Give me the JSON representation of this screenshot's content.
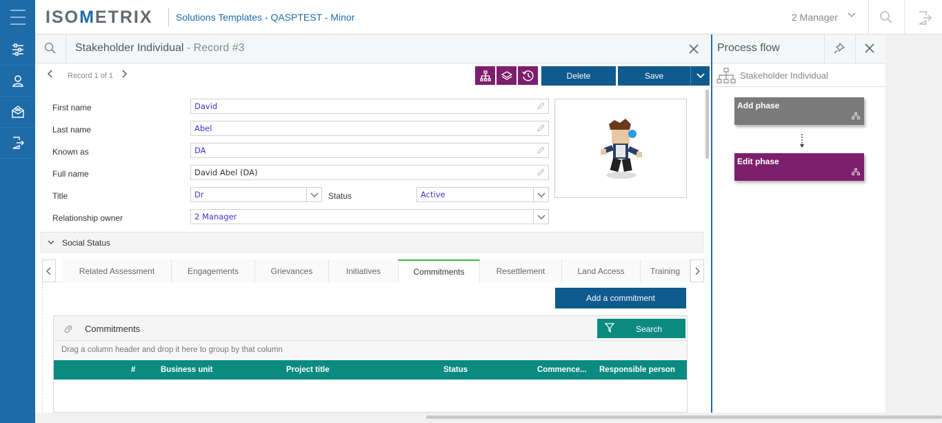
{
  "app": {
    "logo_prefix": "ISO",
    "logo_accent": "M",
    "logo_suffix": "ETRIX",
    "title": "Solutions Templates - QASPTEST - Minor",
    "user": "2 Manager"
  },
  "record": {
    "entity": "Stakeholder Individual",
    "subtitle": "- Record #3",
    "counter": "Record 1 of 1"
  },
  "toolbar": {
    "delete_label": "Delete",
    "save_label": "Save"
  },
  "form": {
    "first_name_label": "First name",
    "first_name": "David",
    "last_name_label": "Last name",
    "last_name": "Abel",
    "known_as_label": "Known as",
    "known_as": "DA",
    "full_name_label": "Full name",
    "full_name": "David Abel (DA)",
    "title_label": "Title",
    "title": "Dr",
    "status_label": "Status",
    "status": "Active",
    "owner_label": "Relationship owner",
    "owner": "2 Manager"
  },
  "section": {
    "label": "Social Status"
  },
  "tabs": [
    {
      "label": "Related Assessment"
    },
    {
      "label": "Engagements"
    },
    {
      "label": "Grievances"
    },
    {
      "label": "Initiatives"
    },
    {
      "label": "Commitments"
    },
    {
      "label": "Resettlement"
    },
    {
      "label": "Land Access"
    },
    {
      "label": "Training"
    }
  ],
  "commitments": {
    "add_label": "Add a commitment",
    "grid_title": "Commitments",
    "search_label": "Search",
    "group_hint": "Drag a column header and drop it here to group by that column",
    "columns": [
      "#",
      "Business unit",
      "Project title",
      "Status",
      "Commence...",
      "Responsible person"
    ]
  },
  "process_flow": {
    "title": "Process flow",
    "entity": "Stakeholder Individual",
    "phases": [
      {
        "label": "Add phase",
        "color": "#7a7a7a"
      },
      {
        "label": "Edit phase",
        "color": "#7d1f6c"
      }
    ]
  },
  "colors": {
    "brand": "#1f6ba8",
    "action": "#0f5a8e",
    "accent_purple": "#7d1f6c",
    "teal": "#0b8a80",
    "tab_active": "#3bb24b"
  }
}
